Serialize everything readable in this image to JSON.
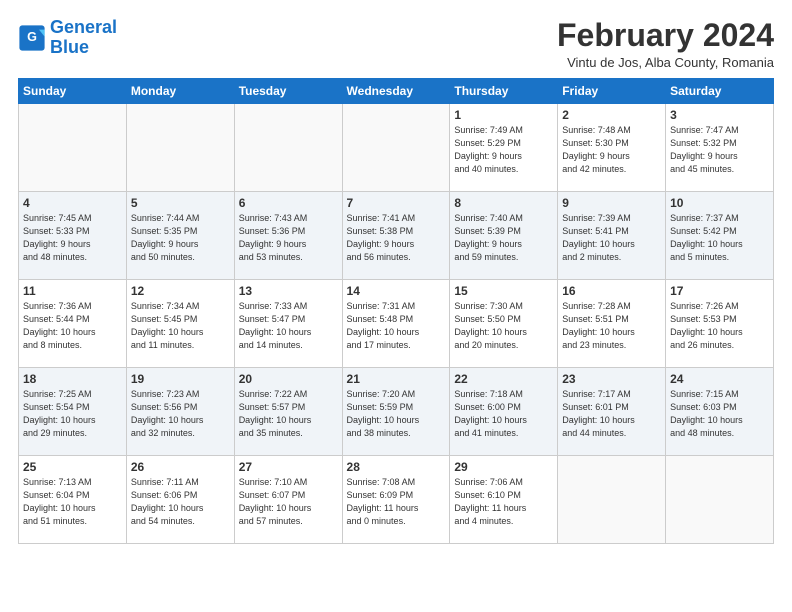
{
  "logo": {
    "line1": "General",
    "line2": "Blue"
  },
  "title": "February 2024",
  "subtitle": "Vintu de Jos, Alba County, Romania",
  "headers": [
    "Sunday",
    "Monday",
    "Tuesday",
    "Wednesday",
    "Thursday",
    "Friday",
    "Saturday"
  ],
  "weeks": [
    [
      {
        "day": "",
        "info": ""
      },
      {
        "day": "",
        "info": ""
      },
      {
        "day": "",
        "info": ""
      },
      {
        "day": "",
        "info": ""
      },
      {
        "day": "1",
        "info": "Sunrise: 7:49 AM\nSunset: 5:29 PM\nDaylight: 9 hours\nand 40 minutes."
      },
      {
        "day": "2",
        "info": "Sunrise: 7:48 AM\nSunset: 5:30 PM\nDaylight: 9 hours\nand 42 minutes."
      },
      {
        "day": "3",
        "info": "Sunrise: 7:47 AM\nSunset: 5:32 PM\nDaylight: 9 hours\nand 45 minutes."
      }
    ],
    [
      {
        "day": "4",
        "info": "Sunrise: 7:45 AM\nSunset: 5:33 PM\nDaylight: 9 hours\nand 48 minutes."
      },
      {
        "day": "5",
        "info": "Sunrise: 7:44 AM\nSunset: 5:35 PM\nDaylight: 9 hours\nand 50 minutes."
      },
      {
        "day": "6",
        "info": "Sunrise: 7:43 AM\nSunset: 5:36 PM\nDaylight: 9 hours\nand 53 minutes."
      },
      {
        "day": "7",
        "info": "Sunrise: 7:41 AM\nSunset: 5:38 PM\nDaylight: 9 hours\nand 56 minutes."
      },
      {
        "day": "8",
        "info": "Sunrise: 7:40 AM\nSunset: 5:39 PM\nDaylight: 9 hours\nand 59 minutes."
      },
      {
        "day": "9",
        "info": "Sunrise: 7:39 AM\nSunset: 5:41 PM\nDaylight: 10 hours\nand 2 minutes."
      },
      {
        "day": "10",
        "info": "Sunrise: 7:37 AM\nSunset: 5:42 PM\nDaylight: 10 hours\nand 5 minutes."
      }
    ],
    [
      {
        "day": "11",
        "info": "Sunrise: 7:36 AM\nSunset: 5:44 PM\nDaylight: 10 hours\nand 8 minutes."
      },
      {
        "day": "12",
        "info": "Sunrise: 7:34 AM\nSunset: 5:45 PM\nDaylight: 10 hours\nand 11 minutes."
      },
      {
        "day": "13",
        "info": "Sunrise: 7:33 AM\nSunset: 5:47 PM\nDaylight: 10 hours\nand 14 minutes."
      },
      {
        "day": "14",
        "info": "Sunrise: 7:31 AM\nSunset: 5:48 PM\nDaylight: 10 hours\nand 17 minutes."
      },
      {
        "day": "15",
        "info": "Sunrise: 7:30 AM\nSunset: 5:50 PM\nDaylight: 10 hours\nand 20 minutes."
      },
      {
        "day": "16",
        "info": "Sunrise: 7:28 AM\nSunset: 5:51 PM\nDaylight: 10 hours\nand 23 minutes."
      },
      {
        "day": "17",
        "info": "Sunrise: 7:26 AM\nSunset: 5:53 PM\nDaylight: 10 hours\nand 26 minutes."
      }
    ],
    [
      {
        "day": "18",
        "info": "Sunrise: 7:25 AM\nSunset: 5:54 PM\nDaylight: 10 hours\nand 29 minutes."
      },
      {
        "day": "19",
        "info": "Sunrise: 7:23 AM\nSunset: 5:56 PM\nDaylight: 10 hours\nand 32 minutes."
      },
      {
        "day": "20",
        "info": "Sunrise: 7:22 AM\nSunset: 5:57 PM\nDaylight: 10 hours\nand 35 minutes."
      },
      {
        "day": "21",
        "info": "Sunrise: 7:20 AM\nSunset: 5:59 PM\nDaylight: 10 hours\nand 38 minutes."
      },
      {
        "day": "22",
        "info": "Sunrise: 7:18 AM\nSunset: 6:00 PM\nDaylight: 10 hours\nand 41 minutes."
      },
      {
        "day": "23",
        "info": "Sunrise: 7:17 AM\nSunset: 6:01 PM\nDaylight: 10 hours\nand 44 minutes."
      },
      {
        "day": "24",
        "info": "Sunrise: 7:15 AM\nSunset: 6:03 PM\nDaylight: 10 hours\nand 48 minutes."
      }
    ],
    [
      {
        "day": "25",
        "info": "Sunrise: 7:13 AM\nSunset: 6:04 PM\nDaylight: 10 hours\nand 51 minutes."
      },
      {
        "day": "26",
        "info": "Sunrise: 7:11 AM\nSunset: 6:06 PM\nDaylight: 10 hours\nand 54 minutes."
      },
      {
        "day": "27",
        "info": "Sunrise: 7:10 AM\nSunset: 6:07 PM\nDaylight: 10 hours\nand 57 minutes."
      },
      {
        "day": "28",
        "info": "Sunrise: 7:08 AM\nSunset: 6:09 PM\nDaylight: 11 hours\nand 0 minutes."
      },
      {
        "day": "29",
        "info": "Sunrise: 7:06 AM\nSunset: 6:10 PM\nDaylight: 11 hours\nand 4 minutes."
      },
      {
        "day": "",
        "info": ""
      },
      {
        "day": "",
        "info": ""
      }
    ]
  ]
}
